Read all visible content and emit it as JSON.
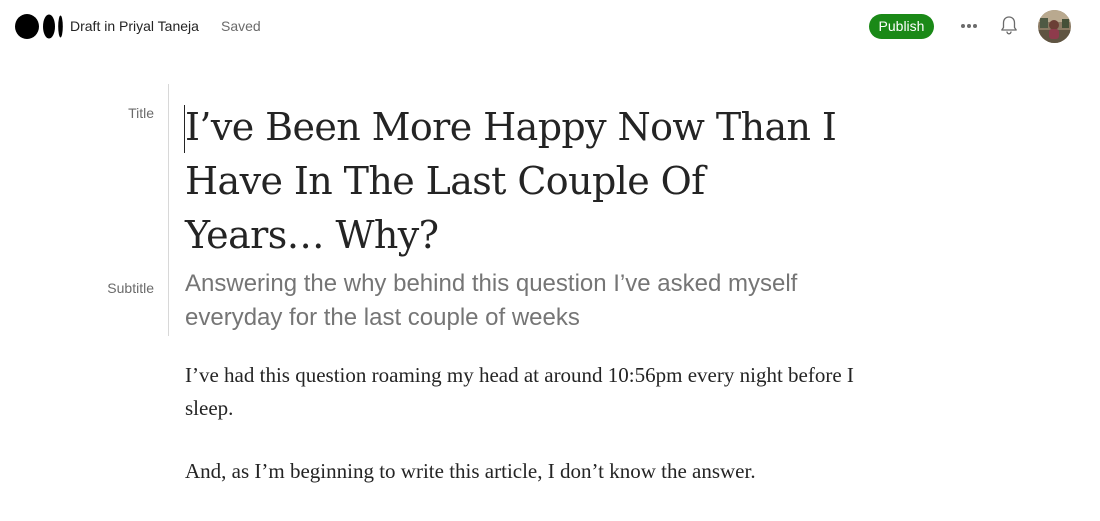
{
  "header": {
    "draft_label": "Draft in Priyal Taneja",
    "saved_status": "Saved",
    "publish_label": "Publish",
    "more_icon": "more-horizontal-icon",
    "bell_icon": "bell-icon",
    "logo_icon": "medium-logo-icon"
  },
  "editor": {
    "title_gutter_label": "Title",
    "subtitle_gutter_label": "Subtitle",
    "title": "I’ve Been More Happy Now Than I Have In The Last Couple Of Years… Why?",
    "subtitle": "Answering the why behind this question I’ve asked myself everyday for the last couple of weeks",
    "paragraphs": [
      "I’ve had this question roaming my head at around 10:56pm every night before I sleep.",
      "And, as I’m beginning to write this article, I don’t know the answer."
    ]
  },
  "colors": {
    "publish_green": "#1a8917",
    "text_dark": "#242424",
    "text_muted": "#6b6b6b",
    "subtitle_gray": "#757575"
  }
}
